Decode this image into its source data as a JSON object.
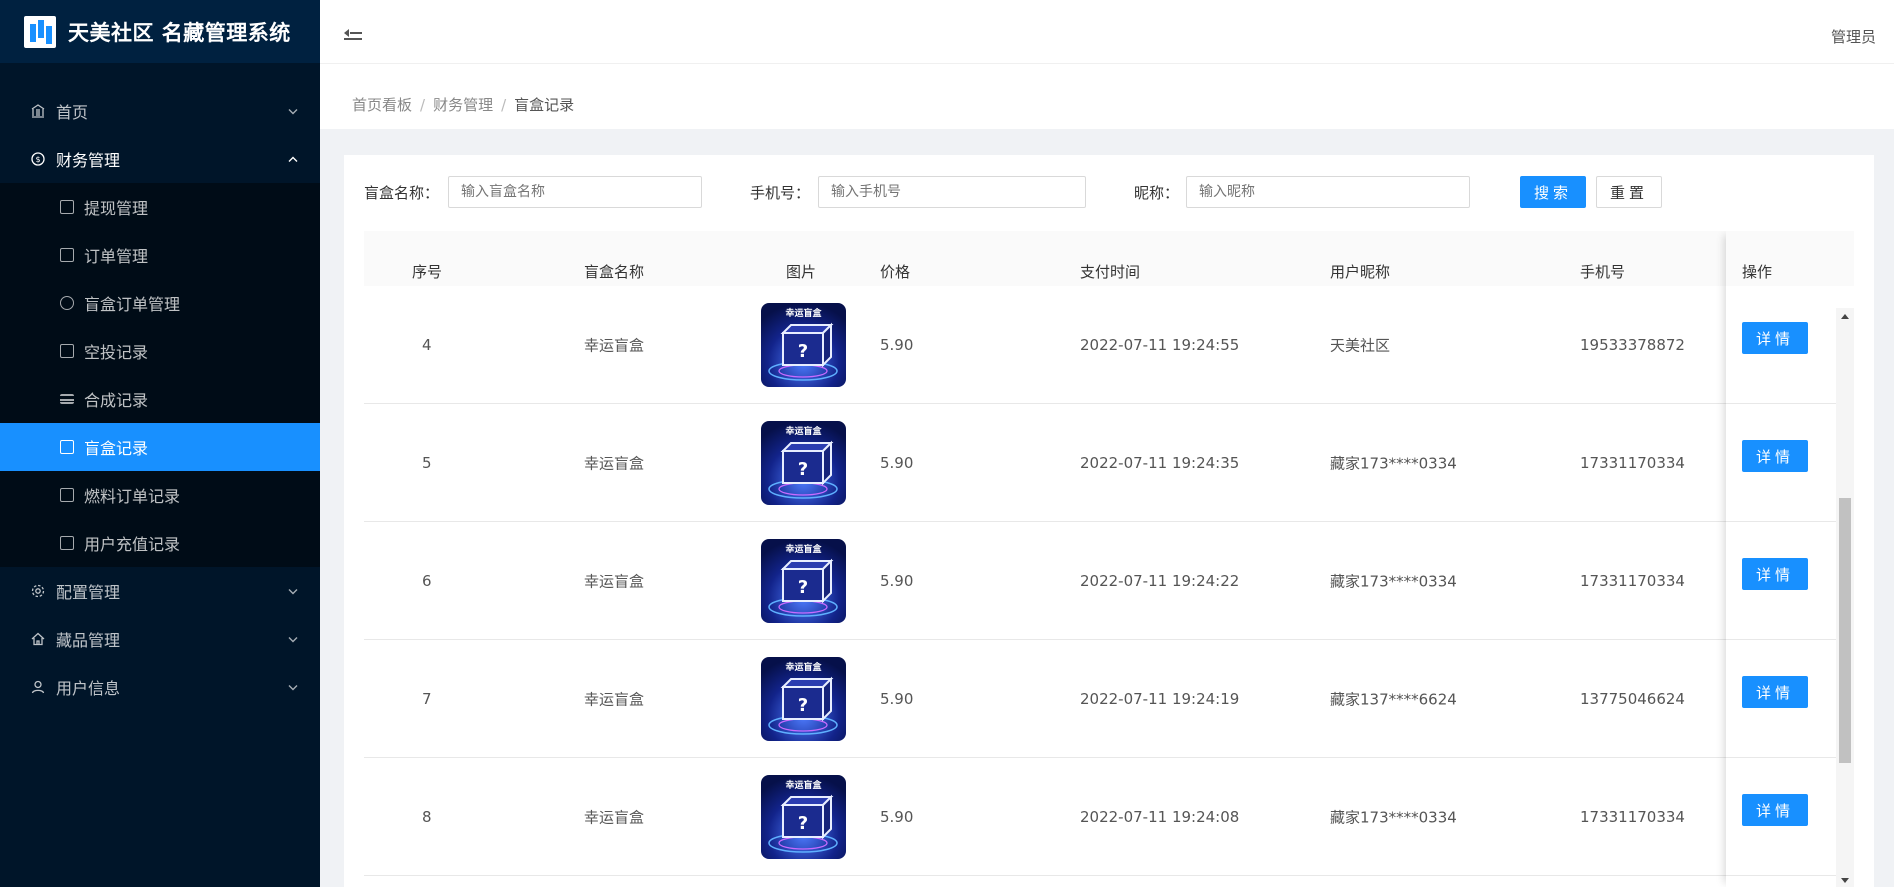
{
  "app": {
    "title": "天美社区 名藏管理系统"
  },
  "sidebar": {
    "items": [
      {
        "label": "首页",
        "icon": "bank-icon"
      },
      {
        "label": "财务管理",
        "icon": "dollar-circle-icon",
        "children": [
          {
            "label": "提现管理",
            "icon": "receipt-icon"
          },
          {
            "label": "订单管理",
            "icon": "table-icon"
          },
          {
            "label": "盲盒订单管理",
            "icon": "dollar-circle-icon"
          },
          {
            "label": "空投记录",
            "icon": "read-icon"
          },
          {
            "label": "合成记录",
            "icon": "list-icon"
          },
          {
            "label": "盲盒记录",
            "icon": "gift-icon",
            "active": true
          },
          {
            "label": "燃料订单记录",
            "icon": "table-icon"
          },
          {
            "label": "用户充值记录",
            "icon": "table-icon"
          }
        ]
      },
      {
        "label": "配置管理",
        "icon": "setting-icon"
      },
      {
        "label": "藏品管理",
        "icon": "home-icon"
      },
      {
        "label": "用户信息",
        "icon": "user-icon"
      }
    ]
  },
  "header": {
    "user": "管理员"
  },
  "breadcrumb": [
    "首页看板",
    "财务管理",
    "盲盒记录"
  ],
  "breadcrumb_sep": "/",
  "search": {
    "box_name_label": "盲盒名称：",
    "box_name_placeholder": "输入盲盒名称",
    "phone_label": "手机号：",
    "phone_placeholder": "输入手机号",
    "nickname_label": "昵称：",
    "nickname_placeholder": "输入昵称",
    "search_btn": "搜索",
    "reset_btn": "重置"
  },
  "table": {
    "columns": [
      "序号",
      "盲盒名称",
      "图片",
      "价格",
      "支付时间",
      "用户昵称",
      "手机号",
      "操作"
    ],
    "detail_label": "详情",
    "image_caption": "幸运盲盒",
    "rows": [
      {
        "index": "4",
        "name": "幸运盲盒",
        "price": "5.90",
        "time": "2022-07-11 19:24:55",
        "nickname": "天美社区",
        "phone": "19533378872"
      },
      {
        "index": "5",
        "name": "幸运盲盒",
        "price": "5.90",
        "time": "2022-07-11 19:24:35",
        "nickname": "藏家173****0334",
        "phone": "17331170334"
      },
      {
        "index": "6",
        "name": "幸运盲盒",
        "price": "5.90",
        "time": "2022-07-11 19:24:22",
        "nickname": "藏家173****0334",
        "phone": "17331170334"
      },
      {
        "index": "7",
        "name": "幸运盲盒",
        "price": "5.90",
        "time": "2022-07-11 19:24:19",
        "nickname": "藏家137****6624",
        "phone": "13775046624"
      },
      {
        "index": "8",
        "name": "幸运盲盒",
        "price": "5.90",
        "time": "2022-07-11 19:24:08",
        "nickname": "藏家173****0334",
        "phone": "17331170334"
      }
    ]
  },
  "colors": {
    "primary": "#1890ff",
    "sidebar_bg": "#001529",
    "submenu_bg": "#000c17"
  }
}
